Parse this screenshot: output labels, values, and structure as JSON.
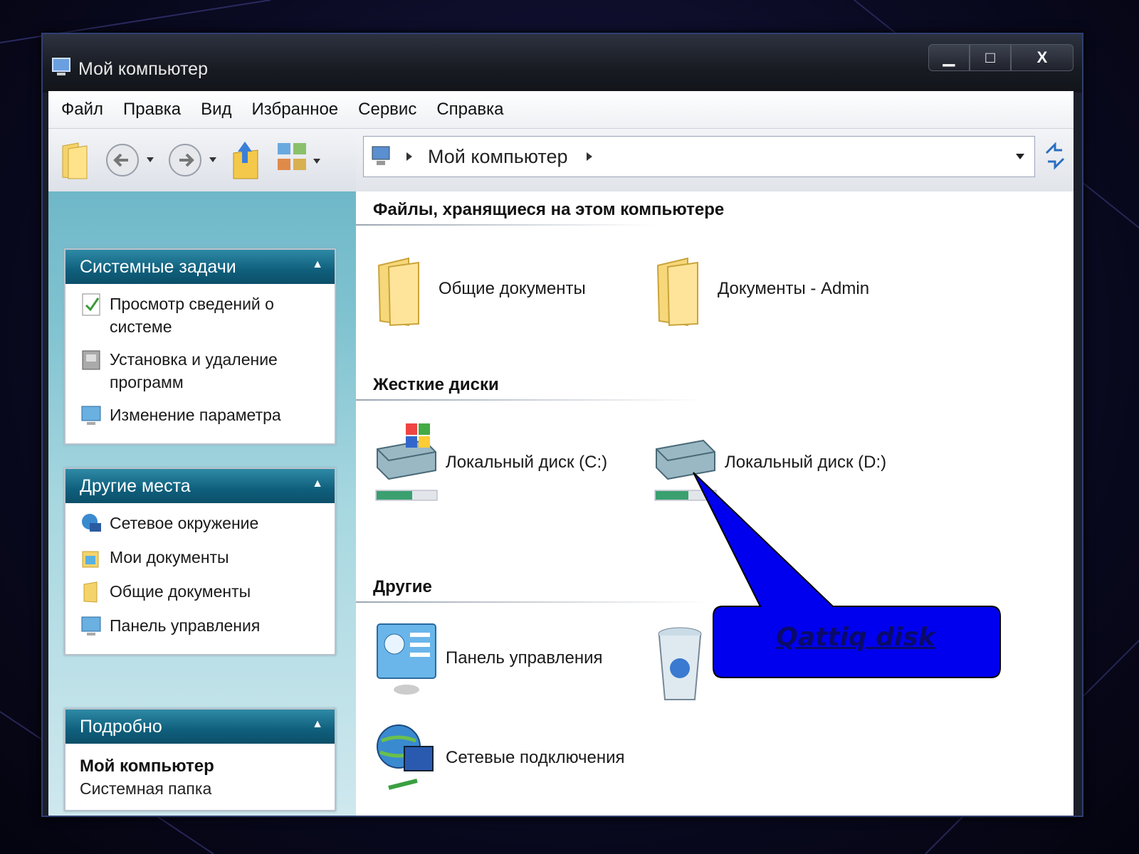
{
  "window": {
    "title": "Мой компьютер",
    "controls": {
      "minimize": "▁",
      "maximize": "□",
      "close": "X"
    }
  },
  "menu": [
    "Файл",
    "Правка",
    "Вид",
    "Избранное",
    "Сервис",
    "Справка"
  ],
  "address": {
    "path": "Мой компьютер"
  },
  "sidebar": {
    "system_tasks": {
      "title": "Системные задачи",
      "items": [
        "Просмотр сведений о системе",
        "Установка и удаление программ",
        "Изменение параметра"
      ]
    },
    "other_places": {
      "title": "Другие места",
      "items": [
        "Сетевое окружение",
        "Мои документы",
        "Общие документы",
        "Панель управления"
      ]
    },
    "details": {
      "title": "Подробно",
      "name": "Мой компьютер",
      "type": "Системная папка"
    }
  },
  "content": {
    "stored_files": {
      "title": "Файлы, хранящиеся на этом компьютере",
      "items": [
        "Общие документы",
        "Документы - Admin"
      ]
    },
    "hard_drives": {
      "title": "Жесткие диски",
      "items": [
        "Локальный диск (C:)",
        "Локальный диск (D:)"
      ],
      "usage": [
        0.6,
        0.55
      ]
    },
    "other": {
      "title": "Другие",
      "items": [
        "Панель управления",
        "Сетевые подключения"
      ]
    }
  },
  "callout": {
    "text": "Qattiq disk"
  },
  "colors": {
    "panel_header": "#0f5f7c",
    "sidebar_bg": "#7fc2d0",
    "callout_fill": "#0000ee"
  }
}
